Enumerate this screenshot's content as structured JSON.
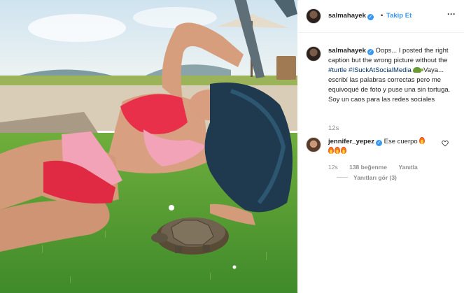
{
  "post": {
    "username": "salmahayek",
    "separator": "•",
    "follow_label": "Takip Et",
    "more_label": "···"
  },
  "caption": {
    "username": "salmahayek",
    "text_1": "Oops... I posted the right caption but the wrong picture without the",
    "hashtag_1": "#turtle",
    "hashtag_2": "#ISuckAtSocialMedia",
    "text_2": "Vaya... escribí las palabras correctas pero me equivoqué de foto y puse una sin tortuga. Soy un caos para las redes sociales",
    "time": "12s"
  },
  "comment": {
    "username": "jennifer_yepez",
    "text": "Ese cuerpo",
    "time": "12s",
    "likes": "138 beğenme",
    "reply_label": "Yanıtla",
    "view_replies": "Yanıtları gör (3)"
  },
  "icons": {
    "verified": "verified-badge-icon",
    "heart": "heart-outline-icon",
    "fire": "fire-emoji-icon",
    "turtle": "turtle-emoji-icon"
  },
  "colors": {
    "link": "#3897f0",
    "hashtag": "#003569",
    "muted": "#8e8e8e",
    "border": "#dbdbdb"
  }
}
